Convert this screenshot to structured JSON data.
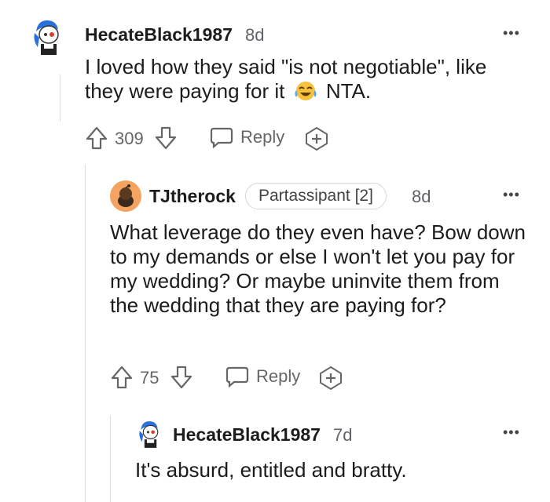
{
  "comments": [
    {
      "username": "HecateBlack1987",
      "age": "8d",
      "text": "I loved how they said \"is not negotiable\", like they were paying for it",
      "text_tail": "NTA.",
      "emoji": "tears-of-joy-emoji",
      "votes": "309",
      "reply_label": "Reply"
    },
    {
      "username": "TJtherock",
      "flair": "Partassipant [2]",
      "age": "8d",
      "text": "What leverage do they even have? Bow down to my demands or else I won't let you pay for my wedding? Or maybe uninvite them from the wedding that they are paying for?",
      "votes": "75",
      "reply_label": "Reply"
    },
    {
      "username": "HecateBlack1987",
      "age": "7d",
      "text": "It's absurd, entitled and bratty."
    }
  ],
  "menu_label": "•••",
  "colors": {
    "text": "#1c1c1c",
    "muted": "#666666",
    "line": "#dcdcdc",
    "avatar_orange": "#f4a460",
    "avatar_blue": "#2a6fdb"
  }
}
